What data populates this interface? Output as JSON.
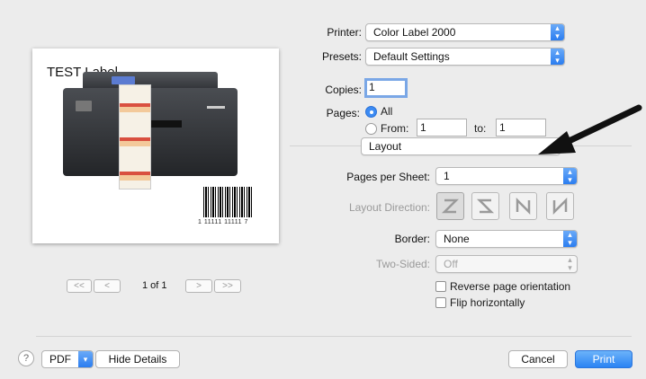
{
  "preview": {
    "label_title": "TEST Label",
    "barcode_digits": "1 11111 11111 7",
    "page_indicator": "1 of 1",
    "pager": {
      "first": "<<",
      "prev": "<",
      "next": ">",
      "last": ">>"
    }
  },
  "printer": {
    "label": "Printer:",
    "value": "Color Label 2000"
  },
  "presets": {
    "label": "Presets:",
    "value": "Default Settings"
  },
  "copies": {
    "label": "Copies:",
    "value": "1"
  },
  "pages": {
    "label": "Pages:",
    "all_label": "All",
    "from_label": "From:",
    "from_value": "1",
    "to_label": "to:",
    "to_value": "1",
    "selected": "All"
  },
  "section": {
    "value": "Layout"
  },
  "pages_per_sheet": {
    "label": "Pages per Sheet:",
    "value": "1"
  },
  "layout_direction": {
    "label": "Layout Direction:",
    "options": [
      "z-icon",
      "reverse-z-icon",
      "n-down-icon",
      "reverse-n-icon"
    ],
    "selected": 0
  },
  "border": {
    "label": "Border:",
    "value": "None"
  },
  "two_sided": {
    "label": "Two-Sided:",
    "value": "Off"
  },
  "reverse_orientation": {
    "label": "Reverse page orientation",
    "checked": false
  },
  "flip_horizontally": {
    "label": "Flip horizontally",
    "checked": false
  },
  "footer": {
    "help": "?",
    "pdf": "PDF",
    "hide_details": "Hide Details",
    "cancel": "Cancel",
    "print": "Print"
  },
  "colors": {
    "accent": "#2b7df0",
    "annotation_arrow": "#111111"
  }
}
